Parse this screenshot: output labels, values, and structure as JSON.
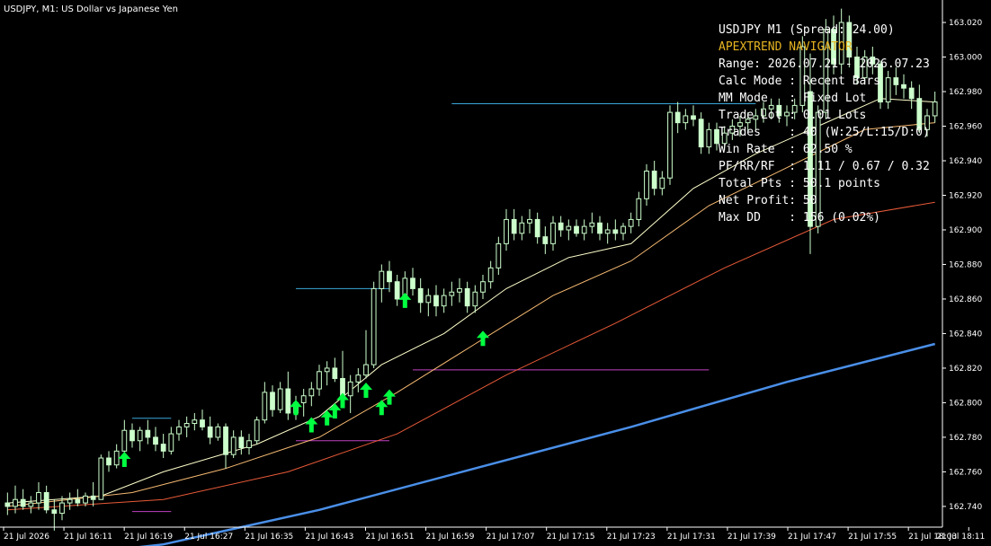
{
  "window": {
    "title": "USDJPY, M1:  US Dollar vs Japanese Yen"
  },
  "panel": {
    "lines": [
      "USDJPY M1 (Spread: 24.00)",
      "APEXTREND NAVIGATOR",
      "Range: 2026.07.21 - 2026.07.23",
      "Calc Mode : Recent Bars",
      "MM Mode   : Fixed Lot",
      "Trade Lot : 0.01 Lots",
      "Trades    : 40 (W:25/L:15/D:0)",
      "Win Rate  : 62.50 %",
      "PF/RR/RF  : 1.11 / 0.67 / 0.32",
      "Total Pts : 50.1 points",
      "Net Profit: 50",
      "Max DD    : 156 (0.02%)"
    ]
  },
  "colors": {
    "background": "#000000",
    "bull_candle": "#ccffcc",
    "bear_candle": "#ccffcc",
    "wick": "#ccffcc",
    "ma_fast": "#ffffcc",
    "ma_mid": "#f5b971",
    "ma_slow": "#e85a38",
    "ma_long": "#4a8fe8",
    "signal_arrow": "#00ff40",
    "level_blue": "#3aa7d8",
    "level_magenta": "#c040c0",
    "panel_title": "#e6b422"
  },
  "chart_data": {
    "type": "candlestick",
    "symbol": "USDJPY",
    "timeframe": "M1",
    "y_ticks": [
      "163.020",
      "163.000",
      "162.980",
      "162.960",
      "162.940",
      "162.920",
      "162.900",
      "162.880",
      "162.860",
      "162.840",
      "162.820",
      "162.800",
      "162.780",
      "162.760",
      "162.740"
    ],
    "x_ticks": [
      "21 Jul 2026",
      "21 Jul 16:11",
      "21 Jul 16:19",
      "21 Jul 16:27",
      "21 Jul 16:35",
      "21 Jul 16:43",
      "21 Jul 16:51",
      "21 Jul 16:59",
      "21 Jul 17:07",
      "21 Jul 17:15",
      "21 Jul 17:23",
      "21 Jul 17:31",
      "21 Jul 17:39",
      "21 Jul 17:47",
      "21 Jul 17:55",
      "21 Jul 18:03",
      "21 Jul 18:11"
    ],
    "ylim": [
      162.728,
      163.033
    ],
    "candles": [
      [
        162.742,
        162.748,
        162.735,
        162.74
      ],
      [
        162.74,
        162.752,
        162.736,
        162.744
      ],
      [
        162.744,
        162.75,
        162.738,
        162.74
      ],
      [
        162.74,
        162.746,
        162.736,
        162.742
      ],
      [
        162.742,
        162.754,
        162.738,
        162.748
      ],
      [
        162.748,
        162.752,
        162.736,
        162.738
      ],
      [
        162.738,
        162.744,
        162.726,
        162.736
      ],
      [
        162.736,
        162.746,
        162.732,
        162.742
      ],
      [
        162.742,
        162.748,
        162.738,
        162.744
      ],
      [
        162.744,
        162.75,
        162.74,
        162.742
      ],
      [
        162.742,
        162.748,
        162.74,
        162.746
      ],
      [
        162.746,
        162.754,
        162.74,
        162.744
      ],
      [
        162.744,
        162.77,
        162.744,
        162.768
      ],
      [
        162.768,
        162.772,
        162.76,
        162.764
      ],
      [
        162.764,
        162.776,
        162.762,
        162.772
      ],
      [
        162.772,
        162.79,
        162.77,
        162.784
      ],
      [
        162.784,
        162.788,
        162.774,
        162.778
      ],
      [
        162.778,
        162.786,
        162.772,
        162.784
      ],
      [
        162.784,
        162.79,
        162.776,
        162.78
      ],
      [
        162.78,
        162.786,
        162.772,
        162.776
      ],
      [
        162.776,
        162.782,
        162.768,
        162.772
      ],
      [
        162.772,
        162.786,
        162.77,
        162.782
      ],
      [
        162.782,
        162.79,
        162.778,
        162.786
      ],
      [
        162.786,
        162.792,
        162.78,
        162.788
      ],
      [
        162.788,
        162.794,
        162.784,
        162.79
      ],
      [
        162.79,
        162.796,
        162.784,
        162.786
      ],
      [
        162.786,
        162.792,
        162.776,
        162.78
      ],
      [
        162.78,
        162.788,
        162.778,
        162.786
      ],
      [
        162.786,
        162.788,
        162.762,
        162.77
      ],
      [
        162.77,
        162.784,
        162.768,
        162.78
      ],
      [
        162.78,
        162.784,
        162.77,
        162.774
      ],
      [
        162.774,
        162.782,
        162.77,
        162.778
      ],
      [
        162.778,
        162.792,
        162.776,
        162.79
      ],
      [
        162.79,
        162.812,
        162.788,
        162.806
      ],
      [
        162.806,
        162.81,
        162.792,
        162.796
      ],
      [
        162.796,
        162.812,
        162.794,
        162.808
      ],
      [
        162.808,
        162.818,
        162.79,
        162.794
      ],
      [
        162.794,
        162.804,
        162.79,
        162.8
      ],
      [
        162.8,
        162.808,
        162.792,
        162.804
      ],
      [
        162.804,
        162.812,
        162.798,
        162.808
      ],
      [
        162.808,
        162.822,
        162.804,
        162.818
      ],
      [
        162.818,
        162.824,
        162.81,
        162.82
      ],
      [
        162.82,
        162.826,
        162.812,
        162.814
      ],
      [
        162.814,
        162.83,
        162.8,
        162.804
      ],
      [
        162.804,
        162.816,
        162.794,
        162.812
      ],
      [
        162.812,
        162.82,
        162.806,
        162.816
      ],
      [
        162.816,
        162.842,
        162.814,
        162.822
      ],
      [
        162.822,
        162.87,
        162.82,
        162.866
      ],
      [
        162.866,
        162.88,
        162.858,
        162.876
      ],
      [
        162.876,
        162.882,
        162.864,
        162.87
      ],
      [
        162.87,
        162.874,
        162.856,
        162.86
      ],
      [
        162.86,
        162.876,
        162.856,
        162.872
      ],
      [
        162.872,
        162.878,
        162.862,
        162.866
      ],
      [
        162.866,
        162.872,
        162.852,
        162.858
      ],
      [
        162.858,
        162.866,
        162.85,
        162.862
      ],
      [
        162.862,
        162.868,
        162.85,
        162.856
      ],
      [
        162.856,
        162.866,
        162.852,
        162.862
      ],
      [
        162.862,
        162.87,
        162.856,
        162.864
      ],
      [
        162.864,
        162.872,
        162.858,
        162.866
      ],
      [
        162.866,
        162.87,
        162.852,
        162.856
      ],
      [
        162.856,
        162.868,
        162.852,
        162.864
      ],
      [
        162.864,
        162.874,
        162.86,
        162.87
      ],
      [
        162.87,
        162.882,
        162.866,
        162.878
      ],
      [
        162.878,
        162.896,
        162.874,
        162.892
      ],
      [
        162.892,
        162.912,
        162.888,
        162.906
      ],
      [
        162.906,
        162.912,
        162.894,
        162.898
      ],
      [
        162.898,
        162.908,
        162.894,
        162.904
      ],
      [
        162.904,
        162.912,
        162.898,
        162.906
      ],
      [
        162.906,
        162.91,
        162.892,
        162.896
      ],
      [
        162.896,
        162.902,
        162.886,
        162.892
      ],
      [
        162.892,
        162.908,
        162.888,
        162.904
      ],
      [
        162.904,
        162.908,
        162.896,
        162.9
      ],
      [
        162.9,
        162.906,
        162.894,
        162.902
      ],
      [
        162.902,
        162.906,
        162.896,
        162.898
      ],
      [
        162.898,
        162.906,
        162.894,
        162.902
      ],
      [
        162.902,
        162.91,
        162.898,
        162.904
      ],
      [
        162.904,
        162.908,
        162.894,
        162.898
      ],
      [
        162.898,
        162.904,
        162.892,
        162.9
      ],
      [
        162.9,
        162.906,
        162.894,
        162.898
      ],
      [
        162.898,
        162.904,
        162.894,
        162.902
      ],
      [
        162.902,
        162.91,
        162.898,
        162.906
      ],
      [
        162.906,
        162.922,
        162.902,
        162.918
      ],
      [
        162.918,
        162.938,
        162.914,
        162.934
      ],
      [
        162.934,
        162.94,
        162.92,
        162.924
      ],
      [
        162.924,
        162.934,
        162.92,
        162.93
      ],
      [
        162.93,
        162.972,
        162.926,
        162.968
      ],
      [
        162.968,
        162.974,
        162.956,
        162.962
      ],
      [
        162.962,
        162.97,
        162.958,
        162.966
      ],
      [
        162.966,
        162.972,
        162.96,
        162.964
      ],
      [
        162.964,
        162.968,
        162.944,
        162.948
      ],
      [
        162.948,
        162.962,
        162.944,
        162.958
      ],
      [
        162.958,
        162.962,
        162.946,
        162.95
      ],
      [
        162.95,
        162.96,
        162.946,
        162.956
      ],
      [
        162.956,
        162.964,
        162.952,
        162.96
      ],
      [
        162.96,
        162.966,
        162.954,
        162.962
      ],
      [
        162.962,
        162.968,
        162.956,
        162.964
      ],
      [
        162.964,
        162.97,
        162.958,
        162.966
      ],
      [
        162.966,
        162.974,
        162.962,
        162.97
      ],
      [
        162.97,
        162.976,
        162.964,
        162.972
      ],
      [
        162.972,
        162.976,
        162.962,
        162.966
      ],
      [
        162.966,
        162.972,
        162.96,
        162.968
      ],
      [
        162.968,
        162.976,
        162.964,
        162.972
      ],
      [
        162.972,
        163.012,
        162.968,
        163.006
      ],
      [
        162.98,
        163.002,
        162.886,
        162.902
      ],
      [
        162.902,
        162.972,
        162.898,
        162.968
      ],
      [
        162.968,
        163.022,
        162.964,
        163.016
      ],
      [
        163.016,
        163.024,
        162.99,
        162.996
      ],
      [
        162.996,
        163.028,
        162.99,
        163.02
      ],
      [
        163.02,
        163.024,
        162.994,
        163.0
      ],
      [
        163.0,
        163.006,
        162.984,
        162.988
      ],
      [
        162.988,
        163.004,
        162.984,
        163.0
      ],
      [
        163.0,
        163.006,
        162.99,
        162.996
      ],
      [
        162.996,
        162.998,
        162.97,
        162.974
      ],
      [
        162.974,
        162.992,
        162.97,
        162.988
      ],
      [
        162.988,
        162.994,
        162.978,
        162.984
      ],
      [
        162.984,
        162.99,
        162.976,
        162.982
      ],
      [
        162.982,
        162.986,
        162.97,
        162.976
      ],
      [
        162.976,
        162.984,
        162.956,
        162.958
      ],
      [
        162.958,
        162.97,
        162.954,
        162.966
      ],
      [
        162.966,
        162.98,
        162.962,
        162.974
      ]
    ],
    "moving_averages": {
      "fast": [
        [
          0,
          162.742
        ],
        [
          12,
          162.746
        ],
        [
          20,
          162.76
        ],
        [
          32,
          162.776
        ],
        [
          40,
          162.792
        ],
        [
          48,
          162.822
        ],
        [
          56,
          162.84
        ],
        [
          64,
          162.866
        ],
        [
          72,
          162.884
        ],
        [
          80,
          162.892
        ],
        [
          88,
          162.924
        ],
        [
          96,
          162.944
        ],
        [
          104,
          162.96
        ],
        [
          112,
          162.976
        ],
        [
          119,
          162.974
        ]
      ],
      "mid": [
        [
          0,
          162.74
        ],
        [
          16,
          162.748
        ],
        [
          28,
          162.762
        ],
        [
          40,
          162.78
        ],
        [
          50,
          162.806
        ],
        [
          60,
          162.834
        ],
        [
          70,
          162.862
        ],
        [
          80,
          162.882
        ],
        [
          90,
          162.914
        ],
        [
          100,
          162.936
        ],
        [
          110,
          162.958
        ],
        [
          119,
          162.962
        ]
      ],
      "slow": [
        [
          0,
          162.738
        ],
        [
          20,
          162.744
        ],
        [
          36,
          162.76
        ],
        [
          50,
          162.782
        ],
        [
          64,
          162.816
        ],
        [
          78,
          162.846
        ],
        [
          92,
          162.878
        ],
        [
          106,
          162.906
        ],
        [
          119,
          162.916
        ]
      ],
      "long": [
        [
          0,
          162.708
        ],
        [
          20,
          162.718
        ],
        [
          40,
          162.738
        ],
        [
          60,
          162.762
        ],
        [
          80,
          162.786
        ],
        [
          100,
          162.812
        ],
        [
          119,
          162.834
        ]
      ]
    },
    "signals": [
      {
        "bar": 15,
        "price": 162.767
      },
      {
        "bar": 37,
        "price": 162.797
      },
      {
        "bar": 39,
        "price": 162.787
      },
      {
        "bar": 41,
        "price": 162.791
      },
      {
        "bar": 42,
        "price": 162.795
      },
      {
        "bar": 43,
        "price": 162.801
      },
      {
        "bar": 46,
        "price": 162.807
      },
      {
        "bar": 48,
        "price": 162.797
      },
      {
        "bar": 49,
        "price": 162.803
      },
      {
        "bar": 51,
        "price": 162.859
      },
      {
        "bar": 61,
        "price": 162.837
      }
    ],
    "levels": [
      {
        "from_bar": 16,
        "to_bar": 21,
        "price": 162.791,
        "color": "level_blue"
      },
      {
        "from_bar": 37,
        "to_bar": 49,
        "price": 162.866,
        "color": "level_blue"
      },
      {
        "from_bar": 57,
        "to_bar": 96,
        "price": 162.973,
        "color": "level_blue"
      },
      {
        "from_bar": 16,
        "to_bar": 21,
        "price": 162.737,
        "color": "level_magenta"
      },
      {
        "from_bar": 37,
        "to_bar": 49,
        "price": 162.778,
        "color": "level_magenta"
      },
      {
        "from_bar": 52,
        "to_bar": 90,
        "price": 162.819,
        "color": "level_magenta"
      }
    ],
    "grid": false
  }
}
